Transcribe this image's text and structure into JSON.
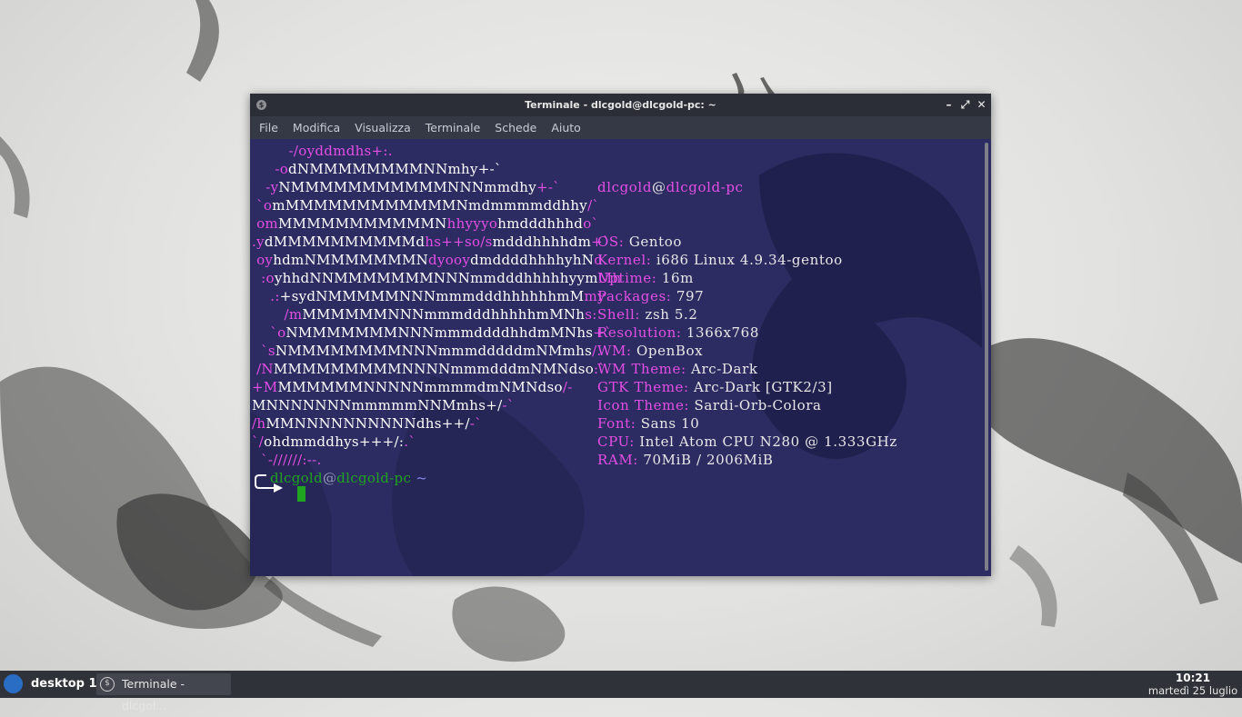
{
  "window": {
    "title": "Terminale - dlcgold@dlcgold-pc: ~",
    "controls": [
      "–",
      "⤢",
      "✕"
    ]
  },
  "menu": [
    "File",
    "Modifica",
    "Visualizza",
    "Terminale",
    "Schede",
    "Aiuto"
  ],
  "logo_lines": [
    [
      [
        "p",
        "        -/oyddmdhs+:."
      ]
    ],
    [
      [
        "p",
        "     -o"
      ],
      [
        "w",
        "dNMMMMMMMMNNmhy+-`"
      ]
    ],
    [
      [
        "p",
        "   -y"
      ],
      [
        "w",
        "NMMMMMMMMMMMNNNmmdhy"
      ],
      [
        "p",
        "+-`"
      ]
    ],
    [
      [
        "p",
        " `o"
      ],
      [
        "w",
        "mMMMMMMMMMMMMNmdmmmmddhhy"
      ],
      [
        "p",
        "/`"
      ]
    ],
    [
      [
        "p",
        " om"
      ],
      [
        "w",
        "MMMMMMMMMMMN"
      ],
      [
        "p",
        "hhyyyo"
      ],
      [
        "w",
        "hmdddhhhd"
      ],
      [
        "p",
        "o`"
      ]
    ],
    [
      [
        "p",
        ".y"
      ],
      [
        "w",
        "dMMMMMMMMMMd"
      ],
      [
        "p",
        "hs++so/s"
      ],
      [
        "w",
        "mdddhhhhdm"
      ],
      [
        "p",
        "+`"
      ]
    ],
    [
      [
        "p",
        " oy"
      ],
      [
        "w",
        "hdmNMMMMMMMN"
      ],
      [
        "p",
        "dyooy"
      ],
      [
        "w",
        "dmddddhhhhyhN"
      ],
      [
        "p",
        "d."
      ]
    ],
    [
      [
        "p",
        "  :o"
      ],
      [
        "w",
        "yhhdNNMMMMMMMNNNmmdddhhhhhyym"
      ],
      [
        "p",
        "Mh"
      ]
    ],
    [
      [
        "p",
        "    .:"
      ],
      [
        "w",
        "+sydNMMMMMNNNmmmdddhhhhhhmM"
      ],
      [
        "p",
        "my"
      ]
    ],
    [
      [
        "p",
        "       /m"
      ],
      [
        "w",
        "MMMMMMNNNmmmdddhhhhhmMNh"
      ],
      [
        "p",
        "s:"
      ]
    ],
    [
      [
        "p",
        "    `o"
      ],
      [
        "w",
        "NMMMMMMMNNNmmmddddhhdmMNhs"
      ],
      [
        "p",
        "+`"
      ]
    ],
    [
      [
        "p",
        "  `s"
      ],
      [
        "w",
        "NMMMMMMMMNNNmmmdddddmNMmhs"
      ],
      [
        "p",
        "/."
      ]
    ],
    [
      [
        "p",
        " /N"
      ],
      [
        "w",
        "MMMMMMMMMNNNNmmmdddmNMNdso"
      ],
      [
        "p",
        ":`"
      ]
    ],
    [
      [
        "p",
        "+M"
      ],
      [
        "w",
        "MMMMMMNNNNNmmmmdmNMNdso"
      ],
      [
        "p",
        "/-"
      ]
    ],
    [
      [
        "w",
        "MNNNNNNNmmmmmNNMmhs+/"
      ],
      [
        "p",
        "-`"
      ]
    ],
    [
      [
        "p",
        "/h"
      ],
      [
        "w",
        "MMNNNNNNNNNNdhs++/"
      ],
      [
        "p",
        "-`"
      ]
    ],
    [
      [
        "p",
        "`/"
      ],
      [
        "w",
        "ohdmmddhys+++/:"
      ],
      [
        "p",
        ".`"
      ]
    ],
    [
      [
        "p",
        "  `-//////:--."
      ]
    ]
  ],
  "sysinfo": {
    "user": "dlcgold",
    "at": "@",
    "host": "dlcgold-pc",
    "rows": [
      {
        "key": "OS:",
        "value": "Gentoo"
      },
      {
        "key": "Kernel:",
        "value": "i686 Linux 4.9.34-gentoo"
      },
      {
        "key": "Uptime:",
        "value": "16m"
      },
      {
        "key": "Packages:",
        "value": "797"
      },
      {
        "key": "Shell:",
        "value": "zsh 5.2"
      },
      {
        "key": "Resolution:",
        "value": "1366x768"
      },
      {
        "key": "WM:",
        "value": "OpenBox"
      },
      {
        "key": "WM Theme:",
        "value": "Arc-Dark"
      },
      {
        "key": "GTK Theme:",
        "value": "Arc-Dark [GTK2/3]"
      },
      {
        "key": "Icon Theme:",
        "value": "Sardi-Orb-Colora"
      },
      {
        "key": "Font:",
        "value": "Sans 10"
      },
      {
        "key": "CPU:",
        "value": "Intel Atom CPU N280 @ 1.333GHz"
      },
      {
        "key": "RAM:",
        "value": "70MiB / 2006MiB"
      }
    ]
  },
  "prompt": {
    "user": "dlcgold",
    "at": "@",
    "host": "dlcgold-pc",
    "dir": "~"
  },
  "taskbar": {
    "desktop": "desktop 1",
    "task_label": "Terminale - dlcgol...",
    "time": "10:21",
    "date": "martedì 25 luglio"
  },
  "colors": {
    "terminal_bg": "#2c2c62",
    "magenta": "#e54ee5",
    "prompt_green": "#1fa51f"
  },
  "icons": {
    "app": "terminal-icon",
    "taskbar_logo": "gentoo-logo-icon"
  }
}
